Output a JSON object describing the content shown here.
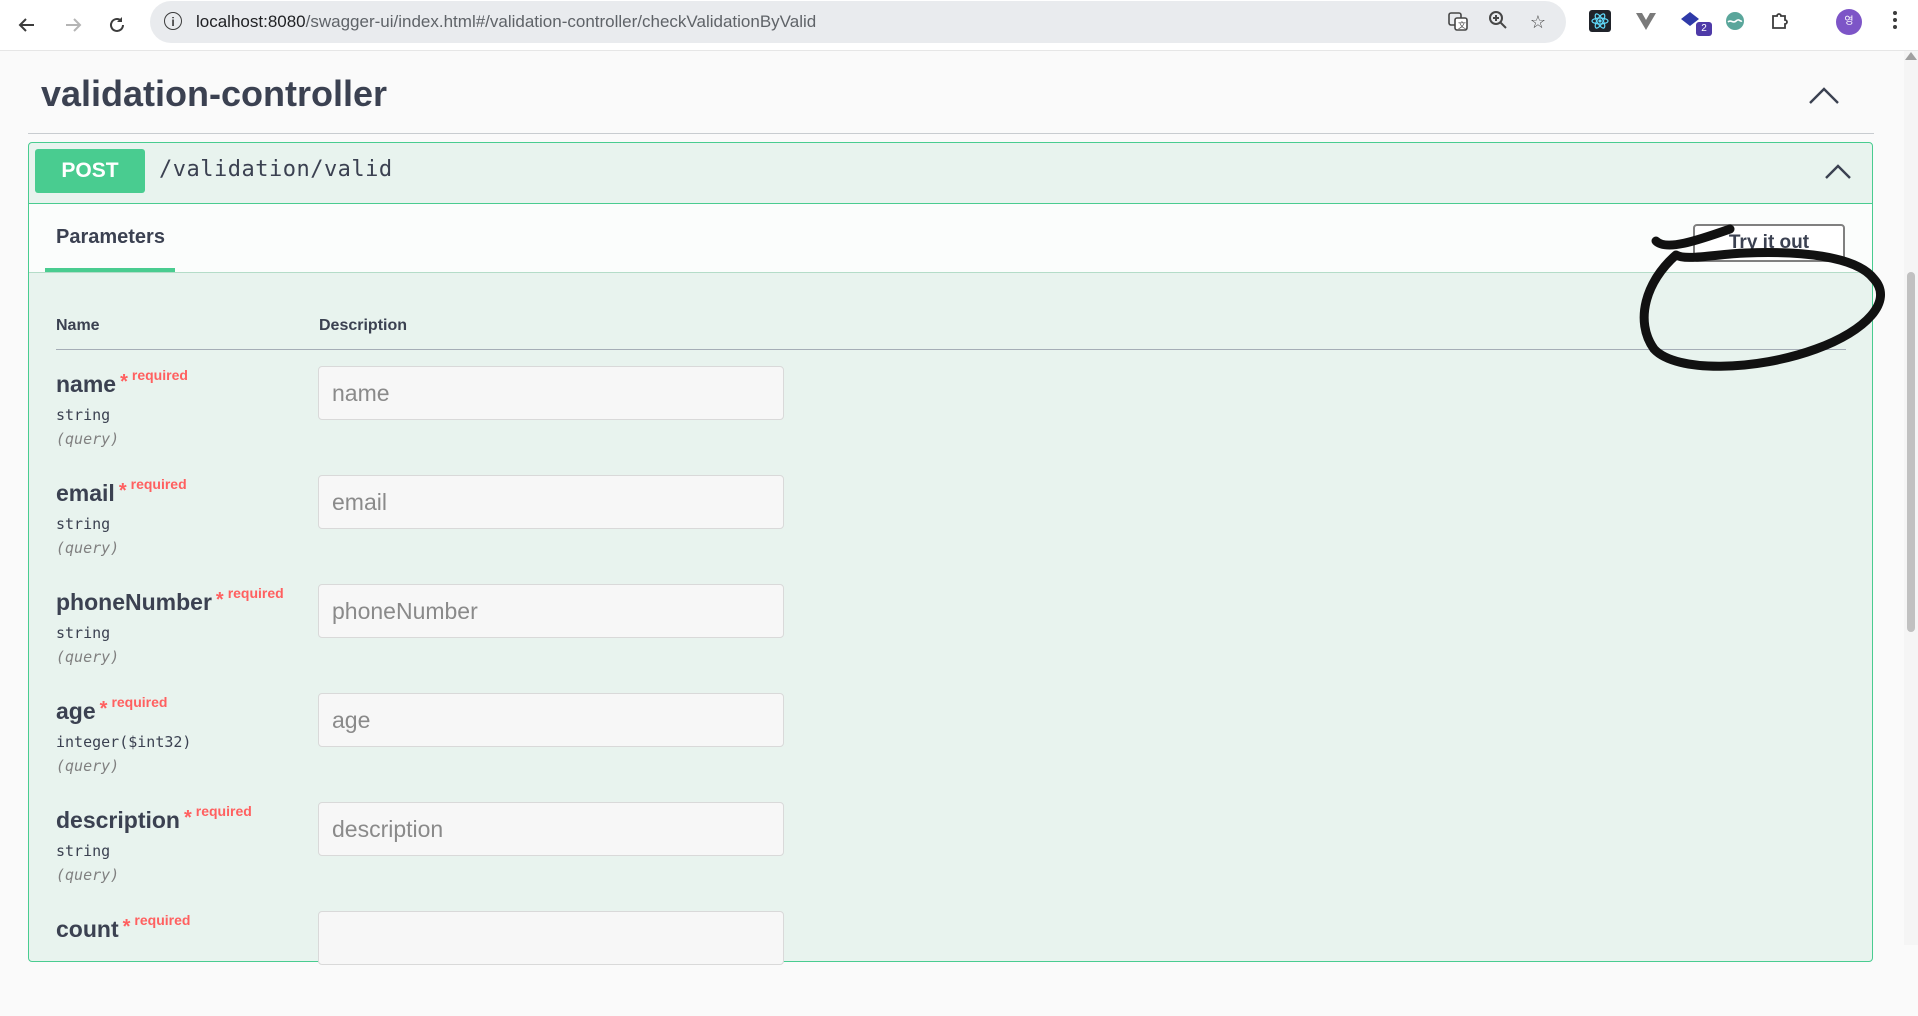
{
  "browser": {
    "url_host": "localhost:8080",
    "url_path": "/swagger-ui/index.html#/validation-controller/checkValidationByValid",
    "extension_badge": "2",
    "avatar_initial": "영"
  },
  "controller": {
    "title": "validation-controller"
  },
  "operation": {
    "method": "POST",
    "path": "/validation/valid",
    "method_color": "#49cc90"
  },
  "parameters": {
    "tab_label": "Parameters",
    "try_button": "Try it out",
    "col_name": "Name",
    "col_description": "Description",
    "items": [
      {
        "name": "name",
        "star": "*",
        "required": "required",
        "type": "string",
        "in": "(query)",
        "placeholder": "name"
      },
      {
        "name": "email",
        "star": "*",
        "required": "required",
        "type": "string",
        "in": "(query)",
        "placeholder": "email"
      },
      {
        "name": "phoneNumber",
        "star": "*",
        "required": "required",
        "type": "string",
        "in": "(query)",
        "placeholder": "phoneNumber"
      },
      {
        "name": "age",
        "star": "*",
        "required": "required",
        "type": "integer($int32)",
        "in": "(query)",
        "placeholder": "age"
      },
      {
        "name": "description",
        "star": "*",
        "required": "required",
        "type": "string",
        "in": "(query)",
        "placeholder": "description"
      },
      {
        "name": "count",
        "star": "*",
        "required": "required",
        "type": "",
        "in": "",
        "placeholder": ""
      }
    ]
  }
}
